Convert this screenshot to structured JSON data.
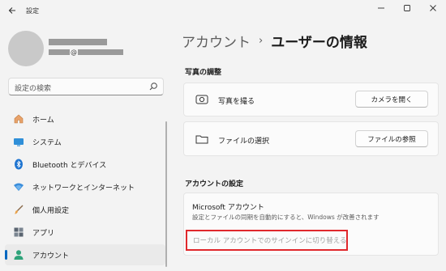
{
  "window": {
    "app_title": "設定",
    "back_icon": "back-arrow-icon",
    "controls": [
      "minimize-icon",
      "maximize-icon",
      "close-icon"
    ]
  },
  "profile": {
    "email_at": "@"
  },
  "search": {
    "placeholder": "設定の検索"
  },
  "sidebar": {
    "items": [
      {
        "label": "ホーム",
        "icon": "home-icon"
      },
      {
        "label": "システム",
        "icon": "system-icon"
      },
      {
        "label": "Bluetooth とデバイス",
        "icon": "bluetooth-icon"
      },
      {
        "label": "ネットワークとインターネット",
        "icon": "network-icon"
      },
      {
        "label": "個人用設定",
        "icon": "personalization-icon"
      },
      {
        "label": "アプリ",
        "icon": "apps-icon"
      },
      {
        "label": "アカウント",
        "icon": "account-icon",
        "selected": true
      }
    ]
  },
  "main": {
    "breadcrumb": {
      "parent": "アカウント",
      "separator": "›",
      "current": "ユーザーの情報"
    },
    "photo_section": {
      "title": "写真の調整",
      "camera": {
        "label": "写真を撮る",
        "button": "カメラを開く"
      },
      "file": {
        "label": "ファイルの選択",
        "button": "ファイルの参照"
      }
    },
    "account_section": {
      "title": "アカウントの設定",
      "ms_title": "Microsoft アカウント",
      "ms_desc": "設定とファイルの同期を自動的にすると、Windows が改善されます",
      "local_link": "ローカル アカウントでのサインインに切り替える"
    }
  },
  "colors": {
    "accent": "#0067c0",
    "highlight_border": "#e0282c"
  }
}
